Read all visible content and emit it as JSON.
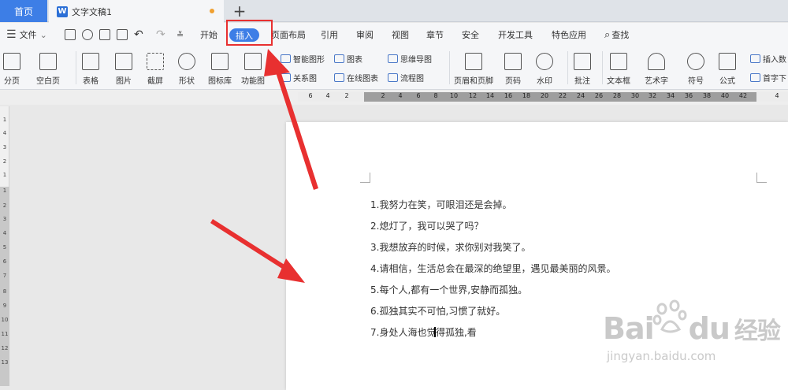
{
  "tabs": {
    "home": "首页",
    "doc_title": "文字文稿1",
    "new_tab": "+"
  },
  "menu": {
    "file": "文件",
    "items": [
      "开始",
      "插入",
      "页面布局",
      "引用",
      "审阅",
      "视图",
      "章节",
      "安全",
      "开发工具",
      "特色应用"
    ],
    "active": "插入",
    "search": "查找"
  },
  "toolbar": {
    "big": [
      {
        "label": "分页",
        "icon": "page-break-icon"
      },
      {
        "label": "空白页",
        "icon": "blank-page-icon"
      },
      {
        "label": "表格",
        "icon": "table-icon"
      },
      {
        "label": "图片",
        "icon": "picture-icon"
      },
      {
        "label": "截屏",
        "icon": "screenshot-icon"
      },
      {
        "label": "形状",
        "icon": "shape-icon"
      },
      {
        "label": "图标库",
        "icon": "icon-library-icon"
      },
      {
        "label": "功能图",
        "icon": "function-chart-icon"
      },
      {
        "label": "页眉和页脚",
        "icon": "header-footer-icon"
      },
      {
        "label": "页码",
        "icon": "page-number-icon"
      },
      {
        "label": "水印",
        "icon": "watermark-icon"
      },
      {
        "label": "批注",
        "icon": "comment-icon"
      },
      {
        "label": "文本框",
        "icon": "textbox-icon"
      },
      {
        "label": "艺术字",
        "icon": "wordart-icon"
      },
      {
        "label": "符号",
        "icon": "symbol-icon"
      },
      {
        "label": "公式",
        "icon": "formula-icon"
      }
    ],
    "small": [
      {
        "label": "智能图形",
        "icon": "smart-graphic-icon"
      },
      {
        "label": "图表",
        "icon": "chart-icon"
      },
      {
        "label": "思维导图",
        "icon": "mindmap-icon"
      },
      {
        "label": "关系图",
        "icon": "relation-icon"
      },
      {
        "label": "在线图表",
        "icon": "online-chart-icon"
      },
      {
        "label": "流程图",
        "icon": "flowchart-icon"
      },
      {
        "label": "插入数",
        "icon": "insert-number-icon"
      },
      {
        "label": "首字下",
        "icon": "drop-cap-icon"
      }
    ]
  },
  "ruler": {
    "h": [
      "6",
      "4",
      "2",
      "2",
      "4",
      "6",
      "8",
      "10",
      "12",
      "14",
      "16",
      "18",
      "20",
      "22",
      "24",
      "26",
      "28",
      "30",
      "32",
      "34",
      "36",
      "38",
      "40",
      "42",
      "4"
    ],
    "v": [
      "1",
      "4",
      "3",
      "2",
      "1",
      "1",
      "2",
      "3",
      "4",
      "5",
      "6",
      "7",
      "8",
      "9",
      "10",
      "11",
      "12",
      "13"
    ]
  },
  "document": {
    "lines": [
      "1.我努力在笑，可眼泪还是会掉。",
      "2.熄灯了，我可以哭了吗？",
      "3.我想放弃的时候，求你别对我笑了。",
      "4.请相信，生活总会在最深的绝望里，遇见最美丽的风景。",
      "5.每个人,都有一个世界,安静而孤独。",
      "6.孤独其实不可怕,习惯了就好。"
    ],
    "last_line_before": "7.身处人海也觉",
    "last_line_after": "得孤独,看"
  },
  "watermark": {
    "brand": "Bai",
    "brand2": "du",
    "site": "经验",
    "url": "jingyan.baidu.com"
  },
  "colors": {
    "accent": "#3d7ee6",
    "highlight": "#e83030"
  }
}
